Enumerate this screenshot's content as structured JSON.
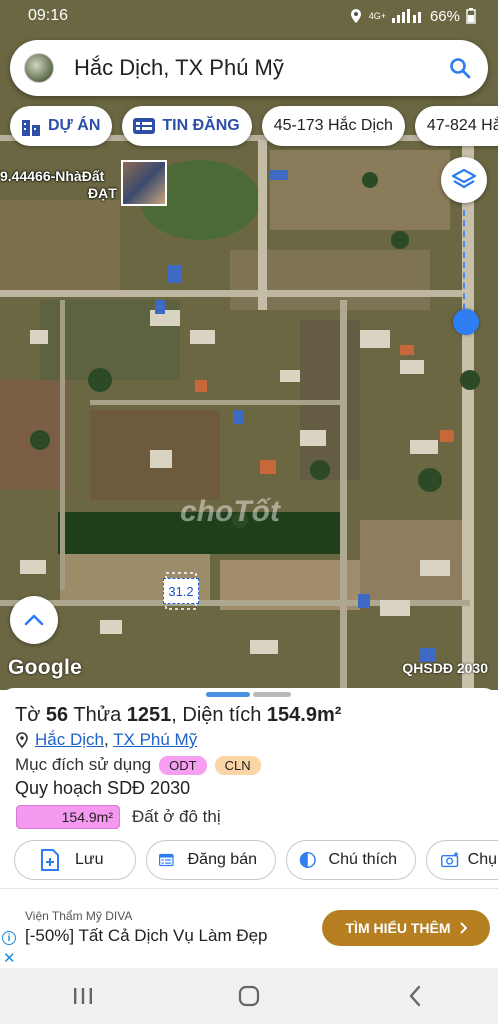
{
  "status": {
    "time": "09:16",
    "network": "4G+",
    "battery": "66%"
  },
  "search": {
    "query": "Hắc Dịch, TX Phú Mỹ"
  },
  "chips": [
    {
      "label": "DỰ ÁN",
      "icon": "building-icon"
    },
    {
      "label": "TIN ĐĂNG",
      "icon": "listing-icon"
    },
    {
      "label": "45-173 Hắc Dịch"
    },
    {
      "label": "47-824 Hắc"
    }
  ],
  "map": {
    "marker_label_line1": "9.44466-NhàĐất",
    "marker_label_line2": "ĐẠT",
    "parcel_label": "31.2",
    "google_logo": "Google",
    "plan_label": "QHSDĐ 2030",
    "watermark": "choTốt"
  },
  "parcel": {
    "to_label": "Tờ",
    "to_number": "56",
    "thua_label": "Thửa",
    "thua_number": "1251",
    "area_label": "Diện tích",
    "area_value": "154.9m²",
    "ward": "Hắc Dịch",
    "town": "TX Phú Mỹ",
    "separator": ",",
    "purpose_label": "Mục đích sử dụng",
    "purpose_tags": [
      "ODT",
      "CLN"
    ],
    "plan_title": "Quy hoạch SDĐ 2030",
    "plan_area": "154.9m²",
    "plan_desc": "Đất ở đô thị"
  },
  "actions": [
    {
      "label": "Lưu",
      "icon": "add-doc-icon"
    },
    {
      "label": "Đăng bán",
      "icon": "calendar-icon"
    },
    {
      "label": "Chú thích",
      "icon": "half-circle-icon"
    },
    {
      "label": "Chụ",
      "icon": "camera-plus-icon"
    }
  ],
  "ad": {
    "brand": "Viện Thẩm Mỹ DIVA",
    "headline": "[-50%] Tất Cả Dịch Vụ Làm Đẹp",
    "cta": "TÌM HIỂU THÊM"
  },
  "colors": {
    "accent": "#2f7df2",
    "odt": "#f59ef2",
    "cln": "#fbd5a6",
    "cta": "#b57f22"
  }
}
